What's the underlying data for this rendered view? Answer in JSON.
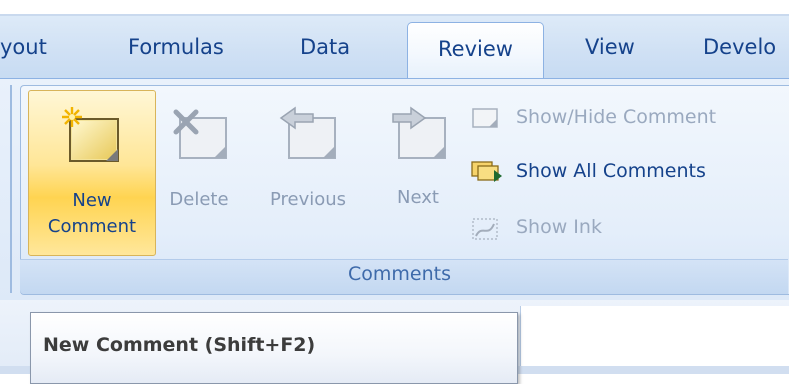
{
  "tabs": {
    "layout": "yout",
    "formulas": "Formulas",
    "data": "Data",
    "review": "Review",
    "view": "View",
    "developer": "Develo"
  },
  "comments_group": {
    "label": "Comments",
    "new_comment": {
      "line1": "New",
      "line2": "Comment"
    },
    "delete": "Delete",
    "previous": "Previous",
    "next": "Next",
    "show_hide_comment": "Show/Hide Comment",
    "show_all_comments": "Show All Comments",
    "show_ink": "Show Ink"
  },
  "tooltip": {
    "title": "New Comment (Shift+F2)"
  },
  "colors": {
    "tab_text": "#15428b",
    "ribbon_bg": "#dde9f8",
    "active_button": "#ffd451",
    "disabled_text": "#8a9bb4"
  }
}
